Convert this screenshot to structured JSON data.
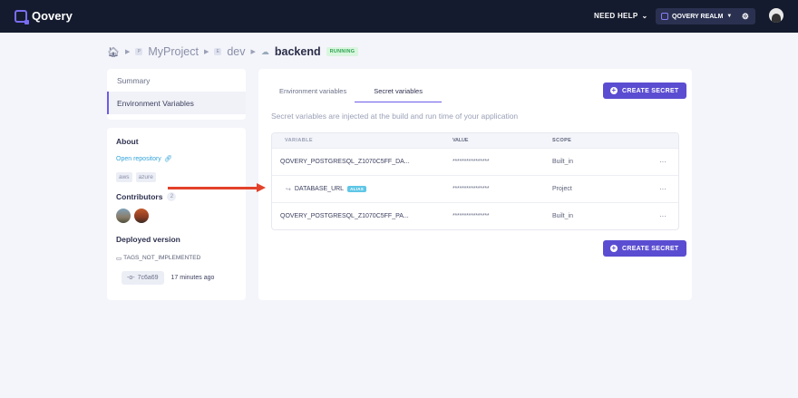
{
  "app": {
    "name": "Qovery"
  },
  "topbar": {
    "need_help": "NEED HELP",
    "realm": "QOVERY REALM"
  },
  "breadcrumb": {
    "project": "MyProject",
    "environment": "dev",
    "application": "backend",
    "status": "RUNNING"
  },
  "sidebar": {
    "items": [
      {
        "label": "Summary"
      },
      {
        "label": "Environment Variables"
      }
    ]
  },
  "about": {
    "title": "About",
    "repo_link": "Open repository",
    "tags": [
      "aws",
      "azure"
    ],
    "contributors_label": "Contributors",
    "contributors_count": "2",
    "deployed_label": "Deployed version",
    "tag_line": "TAGS_NOT_IMPLEMENTED",
    "commit": "7c6a69",
    "commit_time": "17 minutes ago"
  },
  "main": {
    "tabs": [
      {
        "label": "Environment variables"
      },
      {
        "label": "Secret variables"
      }
    ],
    "create_button": "CREATE SECRET",
    "description": "Secret variables are injected at the build and run time of your application",
    "table": {
      "headers": [
        "VARIABLE",
        "VALUE",
        "SCOPE"
      ],
      "rows": [
        {
          "variable": "QOVERY_POSTGRESQL_Z1070C5FF_DA...",
          "value": "****************",
          "scope": "Built_in",
          "actions": "···"
        },
        {
          "variable": "DATABASE_URL",
          "badge": "ALIAS",
          "value": "****************",
          "scope": "Project",
          "actions": "···"
        },
        {
          "variable": "QOVERY_POSTGRESQL_Z1070C5FF_PA...",
          "value": "****************",
          "scope": "Built_in",
          "actions": "···"
        }
      ]
    }
  },
  "colors": {
    "accent": "#5b4dd1",
    "topbar": "#151b2e",
    "arrow": "#e3412a",
    "running": "#2ea44f"
  }
}
